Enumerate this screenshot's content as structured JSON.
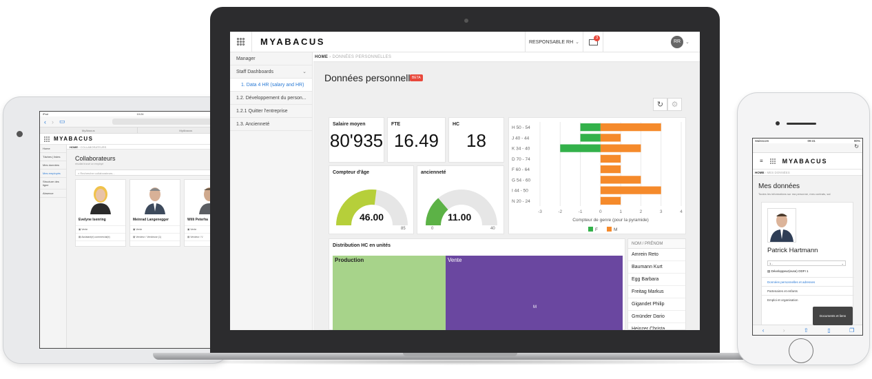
{
  "tablet": {
    "status_carrier": "iPad",
    "status_time": "10:24",
    "browser_tabs": [
      "MyAbacus",
      "MyAbacus"
    ],
    "logo": "MYABACUS",
    "breadcrumb_home": "HOME",
    "breadcrumb_current": "COLLABORATEURS",
    "sidebar": [
      "Home",
      "Tâches | listes",
      "Mes données",
      "Mes employés",
      "Structure des ligne",
      "Absence"
    ],
    "title": "Collaborateurs",
    "subtitle": "résultat trouvé un employé",
    "search_placeholder": "Rechercher collaborateurs...",
    "cards": [
      {
        "name": "Evelyne Isenring",
        "dept": "Vente",
        "role": "Assistant(e) commercial(e)"
      },
      {
        "name": "Meinrad Langenegger",
        "dept": "Vente",
        "role": "Vendeur / Vendeuse (1)"
      },
      {
        "name": "Willi Peterha",
        "dept": "Vente",
        "role": "Vendeur / V"
      }
    ]
  },
  "app": {
    "logo_prefix": "MY",
    "logo_suffix": "ABACUS",
    "role_menu": "RESPONSABLE RH",
    "mail_count": "3",
    "user_initials": "RR",
    "sidebar": {
      "manager": "Manager",
      "staff_dashboards": "Staff Dashboards",
      "items": [
        "1. Data 4 HR (salary and HR)",
        "1.2. Développement du person...",
        "1.2.1 Quitter l'entreprise",
        "1.3. Ancienneté"
      ]
    },
    "breadcrumb_home": "HOME",
    "breadcrumb_current": "DONNÉES PERSONNELLES",
    "page_title": "Données personnelles",
    "beta_badge": "BETA",
    "refresh_icon": "refresh-icon",
    "settings_icon": "settings-icon",
    "kpis": [
      {
        "label": "Salaire moyen",
        "value": "80'935"
      },
      {
        "label": "FTE",
        "value": "16.49"
      },
      {
        "label": "HC",
        "value": "18"
      }
    ],
    "gauges": [
      {
        "label": "Compteur d'âge",
        "value": "46.00",
        "min": "",
        "max": "85",
        "fraction": 0.54,
        "color": "#b6cf3a"
      },
      {
        "label": "ancienneté",
        "value": "11.00",
        "min": "0",
        "max": "40",
        "fraction": 0.275,
        "color": "#5cb246"
      }
    ],
    "treemap": {
      "title": "Distribution HC en unités",
      "blocks": [
        {
          "label": "Production",
          "color": "#a7d38a"
        },
        {
          "label": "Vente",
          "color": "#6a47a0"
        }
      ],
      "marker": "M"
    },
    "employee_list": {
      "header": "NOM / PRÉNOM",
      "names": [
        "Amrein Reto",
        "Baumann Kurt",
        "Egg Barbara",
        "Freitag Markus",
        "Gigandet Philip",
        "Gmünder Dario",
        "Heinzer Christa"
      ]
    }
  },
  "chart_data": {
    "type": "bar",
    "orientation": "horizontal",
    "categories": [
      "H 50 - 54",
      "J 40 - 44",
      "K 34 - 40",
      "D 70 - 74",
      "F 60 - 64",
      "G 54 - 60",
      "I 44 - 50",
      "N 20 - 24"
    ],
    "series": [
      {
        "name": "F",
        "values": [
          -1,
          -1,
          -2,
          0,
          0,
          0,
          0,
          0
        ],
        "color": "#33b14a"
      },
      {
        "name": "M",
        "values": [
          3,
          1,
          2,
          1,
          1,
          2,
          3,
          1
        ],
        "color": "#f58a2b"
      }
    ],
    "xlabel": "Compteur de genre (pour la pyramide)",
    "xlim": [
      -3,
      4
    ],
    "xticks": [
      "-3",
      "-2",
      "-1",
      "0",
      "1",
      "2",
      "3",
      "4"
    ],
    "grid": true,
    "legend": "bottom"
  },
  "phone": {
    "carrier": "Swisscom",
    "time": "09:41",
    "battery": "90%",
    "reload_icon": "reload-icon",
    "logo": "MYABACUS",
    "breadcrumb_home": "HOME",
    "breadcrumb_current": "MES DONNÉES",
    "title": "Mes données",
    "description": "Toutes les informations sur ma personne, mes contrats, sal",
    "name": "Patrick Hartmann",
    "select_value": "1 -",
    "role": "Développeur(euse) ODFI 1",
    "links": [
      "Données personnelles et adresses",
      "Partenaires et enfants",
      "Emploi et organisation"
    ],
    "toast": "Documents et liens"
  }
}
